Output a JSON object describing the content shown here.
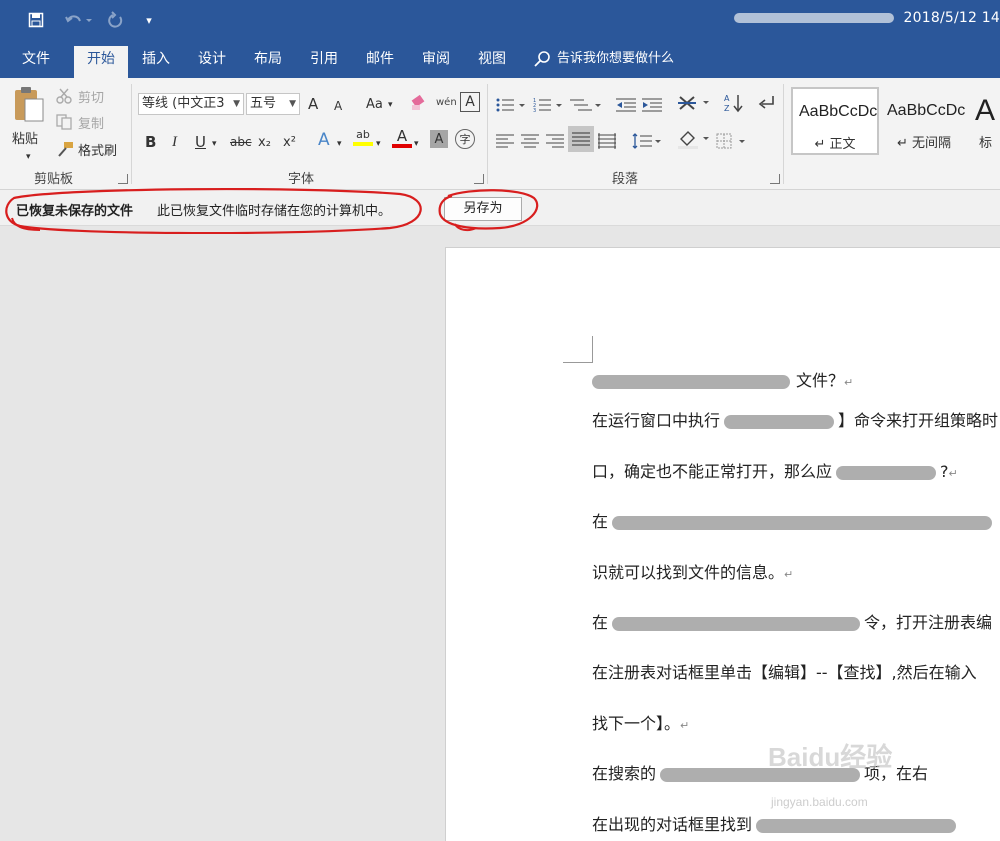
{
  "titlebar": {
    "title": "2018/5/12 14",
    "customize_glyph": "▾",
    "accent": "#2b579a"
  },
  "tabs": [
    {
      "label": "文件"
    },
    {
      "label": "开始"
    },
    {
      "label": "插入"
    },
    {
      "label": "设计"
    },
    {
      "label": "布局"
    },
    {
      "label": "引用"
    },
    {
      "label": "邮件"
    },
    {
      "label": "审阅"
    },
    {
      "label": "视图"
    }
  ],
  "tell_me": {
    "label": "告诉我你想要做什么"
  },
  "clipboard": {
    "paste": "粘贴",
    "cut": "剪切",
    "copy": "复制",
    "format_painter": "格式刷",
    "group": "剪贴板"
  },
  "font": {
    "name": "等线 (中文正3",
    "size": "五号",
    "group": "字体",
    "grow": "A",
    "shrink": "A",
    "case": "Aa",
    "phonetic": "wén",
    "border_char": "A",
    "bold": "B",
    "italic": "I",
    "underline": "U",
    "strike": "abc",
    "subscript": "x₂",
    "superscript": "x²",
    "effects": "A",
    "highlight": "ab",
    "color": "A",
    "shading": "A",
    "enclose": "字"
  },
  "paragraph": {
    "group": "段落"
  },
  "styles": [
    {
      "sample": "AaBbCcDc",
      "name": "↵ 正文"
    },
    {
      "sample": "AaBbCcDc",
      "name": "↵ 无间隔"
    },
    {
      "sample": "A",
      "name": "标"
    }
  ],
  "message_bar": {
    "title": "已恢复未保存的文件",
    "text": "此已恢复文件临时存储在您的计算机中。",
    "button": "另存为"
  },
  "document": {
    "lines": [
      {
        "before": "",
        "after": "文件？"
      },
      {
        "before": "在运行窗口中执行",
        "after": "】命令来打开组策略时"
      },
      {
        "before": "口，确定也不能正常打开，那么应",
        "after": "?"
      },
      {
        "before": "在",
        "after": ""
      },
      {
        "before": "识就可以找到文件的信息。",
        "after": ""
      },
      {
        "before": "在",
        "after": "令，打开注册表编"
      },
      {
        "before": "在注册表对话框里单击【编辑】--【查找】,然后在输入",
        "after": ""
      },
      {
        "before": "找下一个】。",
        "after": ""
      },
      {
        "before": "在搜索的",
        "after": "项，在右"
      },
      {
        "before": "在出现的对话框里找到",
        "after": ""
      }
    ],
    "para_mark": "↵"
  },
  "watermark": {
    "brand": "Baidu经验",
    "url": "jingyan.baidu.com"
  }
}
